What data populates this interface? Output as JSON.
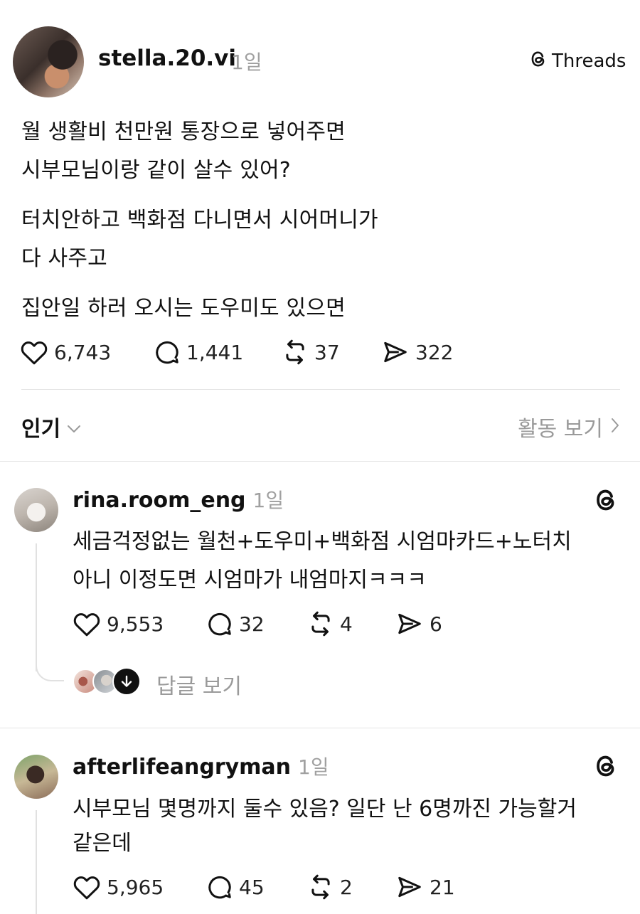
{
  "post": {
    "username": "stella.20.vi",
    "time": "1일",
    "badge_label": "Threads",
    "lines": [
      "월 생활비 천만원 통장으로 넣어주면",
      "시부모님이랑 같이 살수 있어?",
      "터치안하고 백화점 다니면서 시어머니가",
      "다 사주고",
      "집안일 하러 오시는 도우미도 있으면"
    ],
    "stats": {
      "likes": "6,743",
      "comments": "1,441",
      "reposts": "37",
      "shares": "322"
    }
  },
  "sort": {
    "label": "인기",
    "activity_label": "활동 보기"
  },
  "replies": [
    {
      "username": "rina.room_eng",
      "time": "1일",
      "lines": [
        "세금걱정없는 월천+도우미+백화점 시엄마카드+노터치",
        "아니 이정도면 시엄마가 내엄마지ㅋㅋㅋ"
      ],
      "stats": {
        "likes": "9,553",
        "comments": "32",
        "reposts": "4",
        "shares": "6"
      },
      "view_replies": "답글 보기"
    },
    {
      "username": "afterlifeangryman",
      "time": "1일",
      "lines": [
        "시부모님 몇명까지 둘수 있음? 일단 난 6명까진 가능할거",
        "같은데"
      ],
      "stats": {
        "likes": "5,965",
        "comments": "45",
        "reposts": "2",
        "shares": "21"
      }
    }
  ],
  "icons": {
    "like": "heart-icon",
    "comment": "comment-icon",
    "repost": "repost-icon",
    "share": "share-icon",
    "threads": "threads-logo-icon",
    "chevron_down": "chevron-down-icon",
    "chevron_right": "chevron-right-icon",
    "arrow_down": "arrow-down-icon"
  }
}
